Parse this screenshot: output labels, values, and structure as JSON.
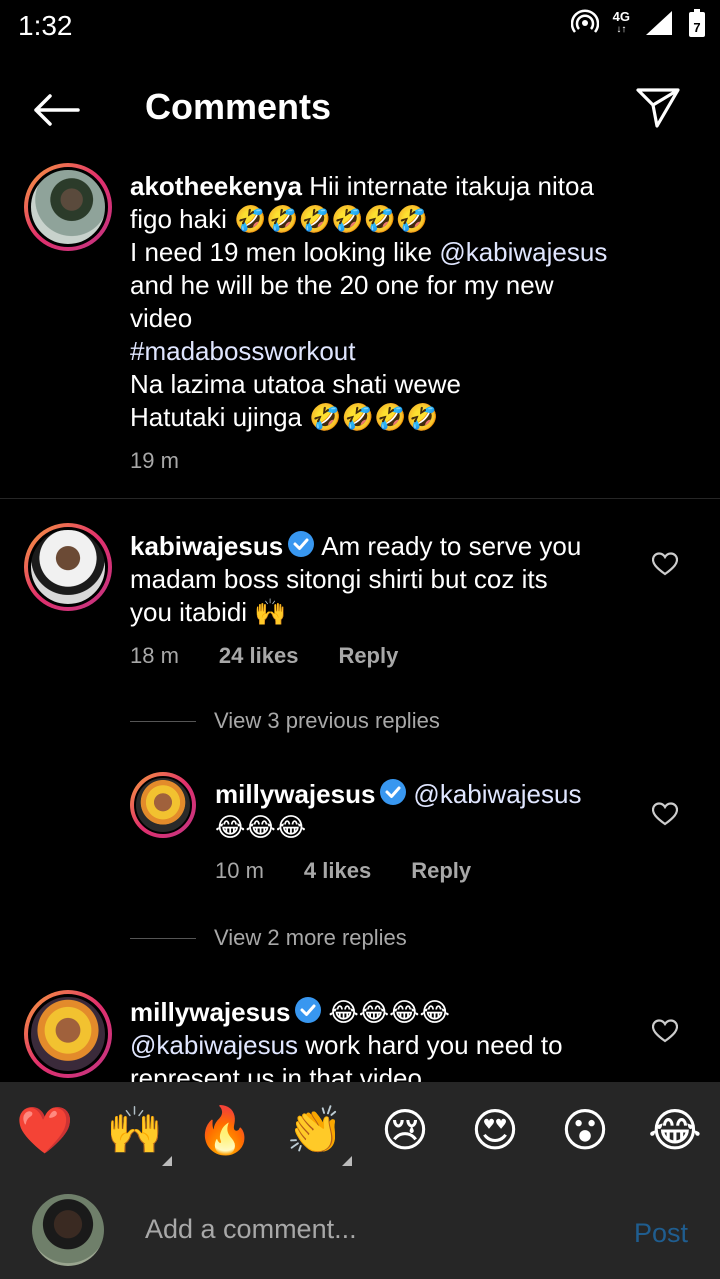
{
  "status": {
    "time": "1:32",
    "network": "4G",
    "battery_level": "7"
  },
  "header": {
    "title": "Comments",
    "back_icon": "back-arrow-icon",
    "send_icon": "paper-plane-icon"
  },
  "comments": [
    {
      "username": "akotheekenya",
      "text_lines": [
        "Hii internate itakuja  nitoa",
        "figo  haki 🤣🤣🤣🤣🤣🤣",
        "I need 19  men looking like ",
        "@kabiwajesus",
        "and he will be the 20 one for my new",
        "video",
        "#madabossworkout",
        "Na lazima utatoa shati wewe",
        "Hatutaki ujinga 🤣🤣🤣🤣"
      ],
      "time": "19 m"
    },
    {
      "username": "kabiwajesus",
      "verified": true,
      "text_lines": [
        "Am ready to serve you",
        "madam boss sitongi shirti but coz its",
        "you itabidi 🙌"
      ],
      "time": "18 m",
      "likes": "24 likes",
      "reply_label": "Reply"
    },
    {
      "username": "millywajesus",
      "verified": true,
      "text_lines": [
        "@kabiwajesus",
        "😂😂😂"
      ],
      "time": "10 m",
      "likes": "4 likes",
      "reply_label": "Reply"
    },
    {
      "username": "millywajesus",
      "verified": true,
      "text_lines": [
        "😂😂😂😂",
        "@kabiwajesus",
        " work hard you need to",
        "represent us in that video"
      ]
    }
  ],
  "view_previous": "View 3 previous replies",
  "view_more": "View 2 more replies",
  "reactions": [
    "❤️",
    "🙌",
    "🔥",
    "👏",
    "😢",
    "😍",
    "😮",
    "😂"
  ],
  "composer": {
    "placeholder": "Add a comment...",
    "post_label": "Post"
  },
  "colors": {
    "accent_disabled": "#1f5d8f",
    "verified": "#3897f0"
  }
}
